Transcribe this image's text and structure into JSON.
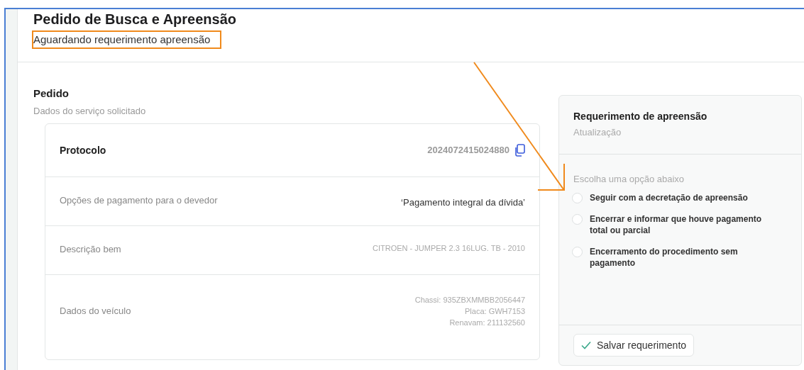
{
  "header": {
    "title": "Pedido de Busca e Apreensão",
    "status": "Aguardando requerimento apreensão"
  },
  "pedido": {
    "title": "Pedido",
    "subtitle": "Dados do serviço solicitado",
    "rows": [
      {
        "kind": "protocol",
        "label": "Protocolo",
        "values": [
          "2024072415024880"
        ]
      },
      {
        "kind": "plain",
        "label": "Opções de pagamento para o devedor",
        "values": [
          "‘Pagamento integral da dívida’"
        ]
      },
      {
        "kind": "muted",
        "label": "Descrição bem",
        "values": [
          "CITROEN - JUMPER 2.3 16LUG. TB - 2010"
        ]
      },
      {
        "kind": "muted",
        "label": "Dados do veículo",
        "values": [
          "Chassi: 935ZBXMMBB2056447",
          "Placa: GWH7153",
          "Renavam: 211132560"
        ]
      }
    ]
  },
  "requerimento": {
    "title": "Requerimento de apreensão",
    "subtitle": "Atualização",
    "prompt": "Escolha uma opção abaixo",
    "options": [
      {
        "label": "Seguir com a decretação de apreensão",
        "selected": false
      },
      {
        "label": "Encerrar e informar que houve pagamento total ou parcial",
        "selected": false
      },
      {
        "label": "Encerramento do procedimento sem pagamento",
        "selected": false
      }
    ],
    "save_button": "Salvar requerimento"
  }
}
